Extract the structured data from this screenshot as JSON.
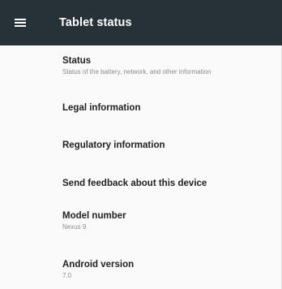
{
  "toolbar": {
    "title": "Tablet status",
    "menu_icon": "hamburger-menu-icon",
    "background": "#263238"
  },
  "items": [
    {
      "title": "Status",
      "summary": "Status of the battery, network, and other information"
    },
    {
      "title": "Legal information",
      "summary": ""
    },
    {
      "title": "Regulatory information",
      "summary": ""
    },
    {
      "title": "Send feedback about this device",
      "summary": ""
    },
    {
      "title": "Model number",
      "summary": "Nexus 9"
    },
    {
      "title": "Android version",
      "summary": "7.0"
    }
  ]
}
